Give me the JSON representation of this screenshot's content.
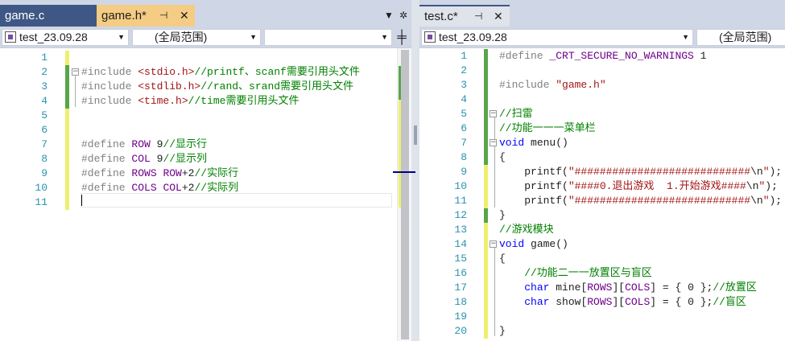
{
  "left_pane": {
    "tabs": [
      {
        "label": "game.c",
        "state": "inactive"
      },
      {
        "label": "game.h*",
        "state": "active"
      }
    ],
    "pin_icon": "pin-icon",
    "close_icon": "close-icon",
    "dropdown_icon": "chevron-down-icon",
    "settings_icon": "gear-icon",
    "nav": {
      "project": "test_23.09.28",
      "scope": "(全局范围)",
      "member": ""
    },
    "lines": [
      {
        "n": "1",
        "tokens": []
      },
      {
        "n": "2",
        "tokens": [
          {
            "t": "#include ",
            "c": "pp"
          },
          {
            "t": "<stdio.h>",
            "c": "str"
          },
          {
            "t": "//printf、scanf需要引用头文件",
            "c": "com"
          }
        ]
      },
      {
        "n": "3",
        "tokens": [
          {
            "t": "#include ",
            "c": "pp"
          },
          {
            "t": "<stdlib.h>",
            "c": "str"
          },
          {
            "t": "//rand、srand需要引用头文件",
            "c": "com"
          }
        ]
      },
      {
        "n": "4",
        "tokens": [
          {
            "t": "#include ",
            "c": "pp"
          },
          {
            "t": "<time.h>",
            "c": "str"
          },
          {
            "t": "//time需要引用头文件",
            "c": "com"
          }
        ]
      },
      {
        "n": "5",
        "tokens": []
      },
      {
        "n": "6",
        "tokens": []
      },
      {
        "n": "7",
        "tokens": [
          {
            "t": "#define ",
            "c": "pp"
          },
          {
            "t": "ROW",
            "c": "mac"
          },
          {
            "t": " 9",
            "c": "txt"
          },
          {
            "t": "//显示行",
            "c": "com"
          }
        ]
      },
      {
        "n": "8",
        "tokens": [
          {
            "t": "#define ",
            "c": "pp"
          },
          {
            "t": "COL",
            "c": "mac"
          },
          {
            "t": " 9",
            "c": "txt"
          },
          {
            "t": "//显示列",
            "c": "com"
          }
        ]
      },
      {
        "n": "9",
        "tokens": [
          {
            "t": "#define ",
            "c": "pp"
          },
          {
            "t": "ROWS",
            "c": "mac"
          },
          {
            "t": " ",
            "c": "txt"
          },
          {
            "t": "ROW",
            "c": "mac"
          },
          {
            "t": "+2",
            "c": "txt"
          },
          {
            "t": "//实际行",
            "c": "com"
          }
        ]
      },
      {
        "n": "10",
        "tokens": [
          {
            "t": "#define ",
            "c": "pp"
          },
          {
            "t": "COLS",
            "c": "mac"
          },
          {
            "t": " ",
            "c": "txt"
          },
          {
            "t": "COL",
            "c": "mac"
          },
          {
            "t": "+2",
            "c": "txt"
          },
          {
            "t": "//实际列",
            "c": "com"
          }
        ]
      },
      {
        "n": "11",
        "tokens": []
      }
    ]
  },
  "right_pane": {
    "tabs": [
      {
        "label": "test.c*",
        "state": "active"
      }
    ],
    "nav": {
      "project": "test_23.09.28",
      "scope": "(全局范围)"
    },
    "lines": [
      {
        "n": "1",
        "tokens": [
          {
            "t": "#define ",
            "c": "pp"
          },
          {
            "t": "_CRT_SECURE_NO_WARNINGS",
            "c": "mac"
          },
          {
            "t": " 1",
            "c": "txt"
          }
        ]
      },
      {
        "n": "2",
        "tokens": []
      },
      {
        "n": "3",
        "tokens": [
          {
            "t": "#include ",
            "c": "pp"
          },
          {
            "t": "\"game.h\"",
            "c": "str"
          }
        ]
      },
      {
        "n": "4",
        "tokens": []
      },
      {
        "n": "5",
        "tokens": [
          {
            "t": "//扫雷",
            "c": "com"
          }
        ]
      },
      {
        "n": "6",
        "tokens": [
          {
            "t": "//功能一一一菜单栏",
            "c": "com"
          }
        ]
      },
      {
        "n": "7",
        "tokens": [
          {
            "t": "void",
            "c": "kw"
          },
          {
            "t": " menu()",
            "c": "txt"
          }
        ]
      },
      {
        "n": "8",
        "tokens": [
          {
            "t": "{",
            "c": "txt"
          }
        ]
      },
      {
        "n": "9",
        "tokens": [
          {
            "t": "    printf(",
            "c": "txt"
          },
          {
            "t": "\"############################",
            "c": "str"
          },
          {
            "t": "\\n",
            "c": "txt"
          },
          {
            "t": "\"",
            "c": "str"
          },
          {
            "t": ");",
            "c": "txt"
          }
        ]
      },
      {
        "n": "10",
        "tokens": [
          {
            "t": "    printf(",
            "c": "txt"
          },
          {
            "t": "\"####0.退出游戏  1.开始游戏####",
            "c": "str"
          },
          {
            "t": "\\n",
            "c": "txt"
          },
          {
            "t": "\"",
            "c": "str"
          },
          {
            "t": ");",
            "c": "txt"
          }
        ]
      },
      {
        "n": "11",
        "tokens": [
          {
            "t": "    printf(",
            "c": "txt"
          },
          {
            "t": "\"############################",
            "c": "str"
          },
          {
            "t": "\\n",
            "c": "txt"
          },
          {
            "t": "\"",
            "c": "str"
          },
          {
            "t": ");",
            "c": "txt"
          }
        ]
      },
      {
        "n": "12",
        "tokens": [
          {
            "t": "}",
            "c": "txt"
          }
        ]
      },
      {
        "n": "13",
        "tokens": [
          {
            "t": "//游戏模块",
            "c": "com"
          }
        ]
      },
      {
        "n": "14",
        "tokens": [
          {
            "t": "void",
            "c": "kw"
          },
          {
            "t": " game()",
            "c": "txt"
          }
        ]
      },
      {
        "n": "15",
        "tokens": [
          {
            "t": "{",
            "c": "txt"
          }
        ]
      },
      {
        "n": "16",
        "tokens": [
          {
            "t": "    //功能二一一放置区与盲区",
            "c": "com"
          }
        ]
      },
      {
        "n": "17",
        "tokens": [
          {
            "t": "    ",
            "c": "txt"
          },
          {
            "t": "char",
            "c": "kw"
          },
          {
            "t": " mine[",
            "c": "txt"
          },
          {
            "t": "ROWS",
            "c": "mac"
          },
          {
            "t": "][",
            "c": "txt"
          },
          {
            "t": "COLS",
            "c": "mac"
          },
          {
            "t": "] = { 0 };",
            "c": "txt"
          },
          {
            "t": "//放置区",
            "c": "com"
          }
        ]
      },
      {
        "n": "18",
        "tokens": [
          {
            "t": "    ",
            "c": "txt"
          },
          {
            "t": "char",
            "c": "kw"
          },
          {
            "t": " show[",
            "c": "txt"
          },
          {
            "t": "ROWS",
            "c": "mac"
          },
          {
            "t": "][",
            "c": "txt"
          },
          {
            "t": "COLS",
            "c": "mac"
          },
          {
            "t": "] = { 0 };",
            "c": "txt"
          },
          {
            "t": "//盲区",
            "c": "com"
          }
        ]
      },
      {
        "n": "19",
        "tokens": []
      },
      {
        "n": "20",
        "tokens": [
          {
            "t": "}",
            "c": "txt"
          }
        ]
      }
    ]
  }
}
